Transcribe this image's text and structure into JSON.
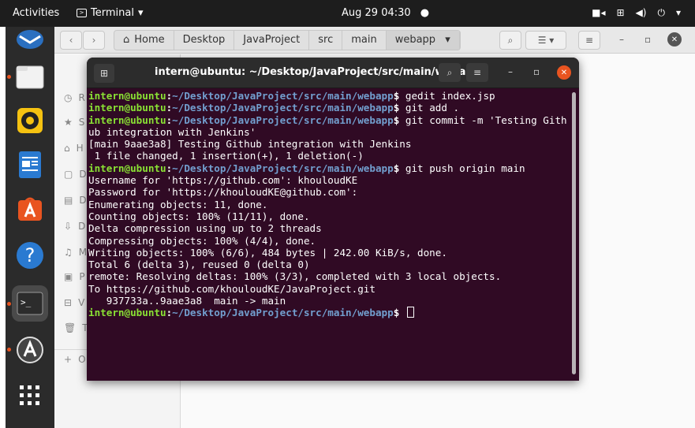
{
  "topbar": {
    "activities": "Activities",
    "app_name": "Terminal",
    "clock": "Aug 29  04:30"
  },
  "files": {
    "crumbs": [
      "Home",
      "Desktop",
      "JavaProject",
      "src",
      "main",
      "webapp"
    ],
    "sidebar_initials": [
      "R",
      "S",
      "H",
      "D",
      "D",
      "D",
      "M",
      "P",
      "V",
      "T"
    ],
    "other_label": "O"
  },
  "terminal": {
    "title": "intern@ubuntu: ~/Desktop/JavaProject/src/main/webapp",
    "prompt_user": "intern@ubuntu",
    "prompt_colon": ":",
    "prompt_path": "~/Desktop/JavaProject/src/main/webapp",
    "prompt_end": "$ ",
    "lines": [
      {
        "prompt": true,
        "text": "gedit index.jsp"
      },
      {
        "prompt": true,
        "text": "git add ."
      },
      {
        "prompt": true,
        "text": "git commit -m 'Testing Gith"
      },
      {
        "prompt": false,
        "text": "ub integration with Jenkins'"
      },
      {
        "prompt": false,
        "text": "[main 9aae3a8] Testing Github integration with Jenkins"
      },
      {
        "prompt": false,
        "text": " 1 file changed, 1 insertion(+), 1 deletion(-)"
      },
      {
        "prompt": true,
        "text": "git push origin main"
      },
      {
        "prompt": false,
        "text": "Username for 'https://github.com': khouloudKE"
      },
      {
        "prompt": false,
        "text": "Password for 'https://khouloudKE@github.com':"
      },
      {
        "prompt": false,
        "text": "Enumerating objects: 11, done."
      },
      {
        "prompt": false,
        "text": "Counting objects: 100% (11/11), done."
      },
      {
        "prompt": false,
        "text": "Delta compression using up to 2 threads"
      },
      {
        "prompt": false,
        "text": "Compressing objects: 100% (4/4), done."
      },
      {
        "prompt": false,
        "text": "Writing objects: 100% (6/6), 484 bytes | 242.00 KiB/s, done."
      },
      {
        "prompt": false,
        "text": "Total 6 (delta 3), reused 0 (delta 0)"
      },
      {
        "prompt": false,
        "text": "remote: Resolving deltas: 100% (3/3), completed with 3 local objects."
      },
      {
        "prompt": false,
        "text": "To https://github.com/khouloudKE/JavaProject.git"
      },
      {
        "prompt": false,
        "text": "   937733a..9aae3a8  main -> main"
      },
      {
        "prompt": true,
        "text": "",
        "cursor": true
      }
    ]
  },
  "colors": {
    "terminal_bg": "#300a24",
    "prompt_user": "#8ae234",
    "prompt_path": "#729fcf",
    "accent": "#e95420"
  }
}
